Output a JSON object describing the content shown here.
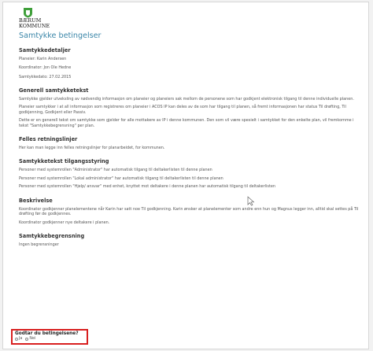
{
  "brand": {
    "line1": "BÆRUM",
    "line2": "KOMMUNE",
    "crest_color": "#3f9f3a"
  },
  "page_title": "Samtykke betingelser",
  "details": {
    "heading": "Samtykkedetaljer",
    "planner": "Planeier: Karin Andersen",
    "coordinator": "Koordinator: Jon Ole Hedne",
    "date": "Samtykkedato: 27.02.2015"
  },
  "general": {
    "heading": "Generell samtykketekst",
    "p1": "Samtykke gjelder utveksling av nødvendig informasjon om planeier og planeiers sak mellom de personene som har godkjent elektronisk tilgang til denne individuelle planen.",
    "p2": "Planeier samtykker i at all informasjon som registreres om planeier i ACOS IP kan deles av de som har tilgang til planen, så fremt informasjonen har status Til drøfting, Til godkjenning, Godkjent eller Passiv.",
    "p3": "Dette er en generell tekst om samtykke som gjelder for alle mottakere av IP i denne kommunen. Den som vil være spesielt i samtykket for den enkelte plan, vil fremkomme i tekst \"Samtykkebegrensning\" per plan."
  },
  "common": {
    "heading": "Felles retningslinjer",
    "p1": "Her kan man legge inn felles retningslinjer for planarbeidet, for kommunen."
  },
  "access": {
    "heading": "Samtykketekst tilgangsstyring",
    "p1": "Personer med systemrollen \"Administrator\" har automatisk tilgang til deltakerlisten til denne planen",
    "p2": "Personer med systemrollen \"Lokal administrator\" har automatisk tilgang til deltakerlisten til denne planen",
    "p3": "Personer med systemrollen \"Hjelp/ ansvar\" med enhet, knyttet mot deltakere i denne planen har automatisk tilgang til deltakerlisten"
  },
  "description": {
    "heading": "Beskrivelse",
    "p1": "Koordinator godkjenner planelementene når Karin har satt noe Til godkjenning. Karin ønsker at planelementer som andre enn hun og Magnus legger inn, alltid skal settes på Til drøfting før de godkjennes.",
    "p2": "Koordinator godkjenner nye deltakere i planen."
  },
  "limits": {
    "heading": "Samtykkebegrensning",
    "p1": "Ingen begrensninger"
  },
  "consent": {
    "question": "Godtar du betingelsene?",
    "yes": "Ja",
    "no": "Nei",
    "highlight_color": "#d81f1f"
  }
}
